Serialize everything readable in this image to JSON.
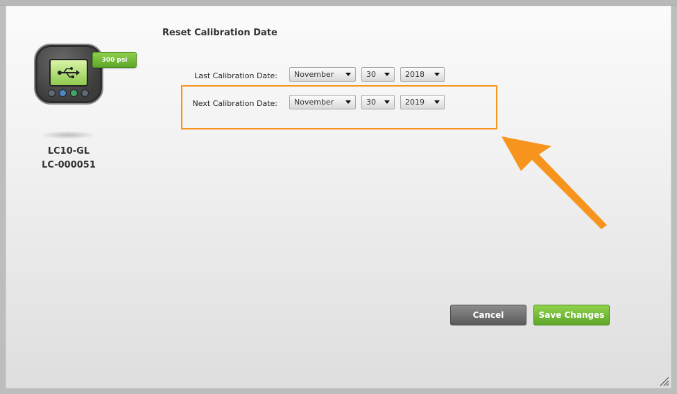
{
  "device": {
    "pressure_badge": "300 psi",
    "model": "LC10-GL",
    "serial": "LC-000051",
    "icon": "usb-icon"
  },
  "dialog": {
    "title": "Reset Calibration Date",
    "last": {
      "label": "Last Calibration Date:",
      "month": "November",
      "day": "30",
      "year": "2018"
    },
    "next": {
      "label": "Next Calibration Date:",
      "month": "November",
      "day": "30",
      "year": "2019"
    }
  },
  "buttons": {
    "cancel": "Cancel",
    "save": "Save Changes"
  },
  "colors": {
    "highlight": "#f7941d",
    "accent_green": "#6cb33f",
    "cancel_gray": "#6e6e6e"
  }
}
